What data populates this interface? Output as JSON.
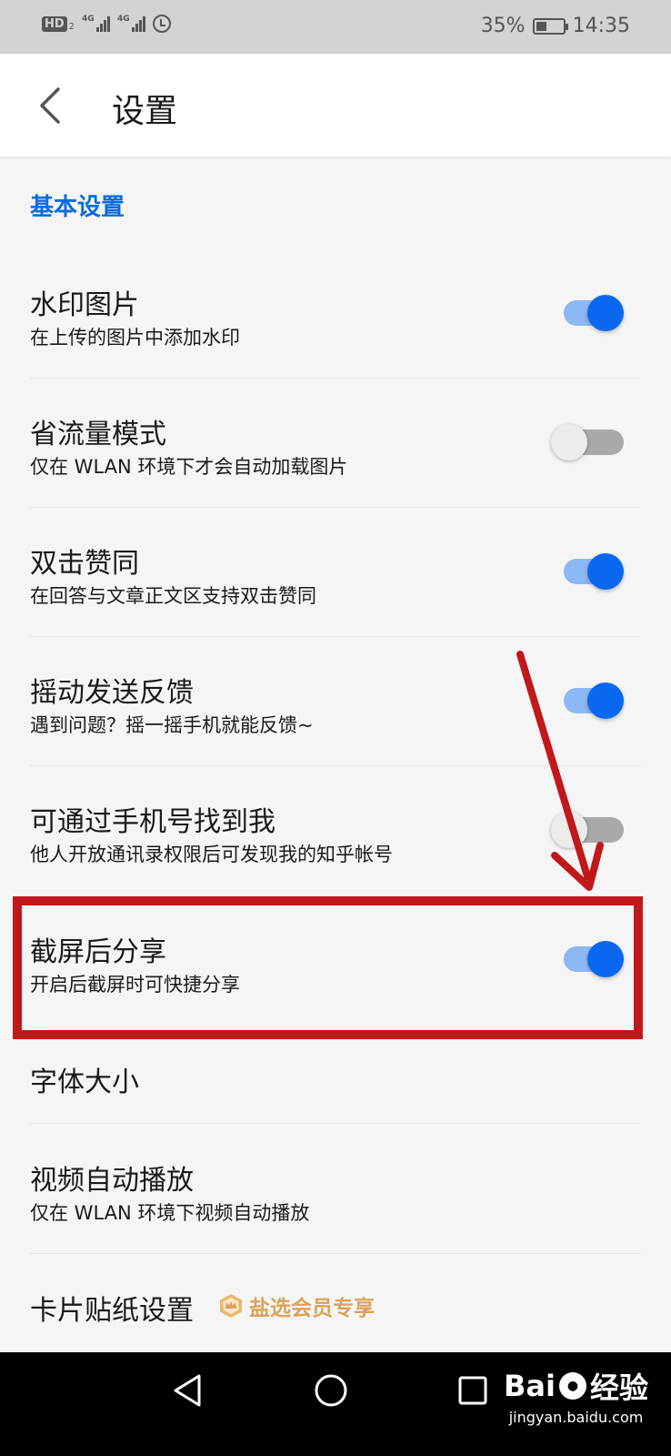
{
  "status_bar": {
    "hd_label": "HD",
    "hd_sub": "2",
    "signal1_label": "4G",
    "signal2_label": "4G",
    "battery_percent": "35%",
    "time": "14:35"
  },
  "header": {
    "title": "设置"
  },
  "section": {
    "title": "基本设置"
  },
  "settings": [
    {
      "title": "水印图片",
      "subtitle": "在上传的图片中添加水印",
      "enabled": true
    },
    {
      "title": "省流量模式",
      "subtitle": "仅在 WLAN 环境下才会自动加载图片",
      "enabled": false
    },
    {
      "title": "双击赞同",
      "subtitle": "在回答与文章正文区支持双击赞同",
      "enabled": true
    },
    {
      "title": "摇动发送反馈",
      "subtitle": "遇到问题？摇一摇手机就能反馈~",
      "enabled": true
    },
    {
      "title": "可通过手机号找到我",
      "subtitle": "他人开放通讯录权限后可发现我的知乎帐号",
      "enabled": false
    },
    {
      "title": "截屏后分享",
      "subtitle": "开启后截屏时可快捷分享",
      "enabled": true
    },
    {
      "title": "字体大小"
    },
    {
      "title": "视频自动播放",
      "subtitle": "仅在 WLAN 环境下视频自动播放"
    },
    {
      "title": "卡片贴纸设置",
      "badge": "盐选会员专享"
    }
  ],
  "watermark": {
    "brand": "Bai",
    "brand_cn": "经验",
    "url": "jingyan.baidu.com"
  },
  "colors": {
    "accent": "#0a68f0",
    "section_title": "#0a6ce0",
    "toggle_track_on": "#8cb8f3",
    "toggle_off": "#a9a9a9",
    "annotation": "#c0181b",
    "vip_gold": "#d9a35a"
  }
}
